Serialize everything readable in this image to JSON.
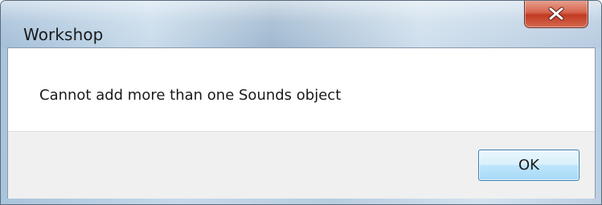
{
  "window": {
    "title": "Workshop"
  },
  "titlebar": {
    "close_icon": "close-icon"
  },
  "dialog": {
    "message": "Cannot add more than one Sounds object",
    "ok_label": "OK"
  },
  "colors": {
    "close_button": "#c13a22",
    "ok_button_border": "#3c7fb1",
    "button_area_bg": "#f0f0f0"
  }
}
